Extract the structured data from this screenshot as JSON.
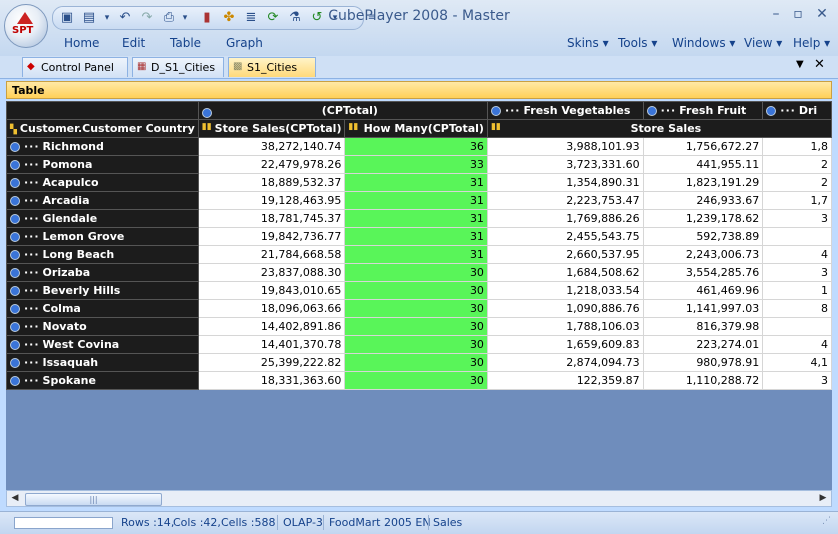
{
  "app": {
    "title": "CubePlayer 2008 - Master",
    "logo_text": "SPT",
    "window_controls": {
      "minimize": "–",
      "maximize": "▫",
      "close": "✕"
    }
  },
  "menu": {
    "left": [
      "Home",
      "Edit",
      "Table",
      "Graph"
    ],
    "right": [
      "Skins",
      "Tools",
      "Windows",
      "View",
      "Help"
    ]
  },
  "tabs": [
    {
      "label": "Control Panel",
      "icon": "spt-icon"
    },
    {
      "label": "D_S1_Cities",
      "icon": "calendar-icon"
    },
    {
      "label": "S1_Cities",
      "icon": "cube-icon",
      "active": true
    }
  ],
  "panel": {
    "title": "Table"
  },
  "table": {
    "top_headers": {
      "cptotal": "(CPTotal)",
      "fresh_veg": "Fresh Vegetables",
      "fresh_fruit": "Fresh Fruit",
      "dri": "Dri"
    },
    "sub_headers": {
      "dimension": "Customer.Customer Country",
      "store_sales_cp": "Store Sales(CPTotal)",
      "how_many_cp": "How Many(CPTotal)",
      "store_sales": "Store Sales"
    },
    "rows": [
      {
        "city": "Richmond",
        "store_sales": "38,272,140.74",
        "how_many": "36",
        "fresh_veg": "3,988,101.93",
        "fresh_fruit": "1,756,672.27",
        "dri": "1,8"
      },
      {
        "city": "Pomona",
        "store_sales": "22,479,978.26",
        "how_many": "33",
        "fresh_veg": "3,723,331.60",
        "fresh_fruit": "441,955.11",
        "dri": "2"
      },
      {
        "city": "Acapulco",
        "store_sales": "18,889,532.37",
        "how_many": "31",
        "fresh_veg": "1,354,890.31",
        "fresh_fruit": "1,823,191.29",
        "dri": "2"
      },
      {
        "city": "Arcadia",
        "store_sales": "19,128,463.95",
        "how_many": "31",
        "fresh_veg": "2,223,753.47",
        "fresh_fruit": "246,933.67",
        "dri": "1,7"
      },
      {
        "city": "Glendale",
        "store_sales": "18,781,745.37",
        "how_many": "31",
        "fresh_veg": "1,769,886.26",
        "fresh_fruit": "1,239,178.62",
        "dri": "3"
      },
      {
        "city": "Lemon Grove",
        "store_sales": "19,842,736.77",
        "how_many": "31",
        "fresh_veg": "2,455,543.75",
        "fresh_fruit": "592,738.89",
        "dri": ""
      },
      {
        "city": "Long Beach",
        "store_sales": "21,784,668.58",
        "how_many": "31",
        "fresh_veg": "2,660,537.95",
        "fresh_fruit": "2,243,006.73",
        "dri": "4"
      },
      {
        "city": "Orizaba",
        "store_sales": "23,837,088.30",
        "how_many": "30",
        "fresh_veg": "1,684,508.62",
        "fresh_fruit": "3,554,285.76",
        "dri": "3"
      },
      {
        "city": "Beverly Hills",
        "store_sales": "19,843,010.65",
        "how_many": "30",
        "fresh_veg": "1,218,033.54",
        "fresh_fruit": "461,469.96",
        "dri": "1"
      },
      {
        "city": "Colma",
        "store_sales": "18,096,063.66",
        "how_many": "30",
        "fresh_veg": "1,090,886.76",
        "fresh_fruit": "1,141,997.03",
        "dri": "8"
      },
      {
        "city": "Novato",
        "store_sales": "14,402,891.86",
        "how_many": "30",
        "fresh_veg": "1,788,106.03",
        "fresh_fruit": "816,379.98",
        "dri": ""
      },
      {
        "city": "West Covina",
        "store_sales": "14,401,370.78",
        "how_many": "30",
        "fresh_veg": "1,659,609.83",
        "fresh_fruit": "223,274.01",
        "dri": "4"
      },
      {
        "city": "Issaquah",
        "store_sales": "25,399,222.82",
        "how_many": "30",
        "fresh_veg": "2,874,094.73",
        "fresh_fruit": "980,978.91",
        "dri": "4,1"
      },
      {
        "city": "Spokane",
        "store_sales": "18,331,363.60",
        "how_many": "30",
        "fresh_veg": "122,359.87",
        "fresh_fruit": "1,110,288.72",
        "dri": "3"
      }
    ]
  },
  "status": {
    "rows": "Rows :14",
    "cols": "Cols :42",
    "cells": "Cells :588",
    "olap": "OLAP-3",
    "db": "FoodMart 2005 EN",
    "cube": "Sales"
  },
  "colors": {
    "highlight_green": "#59f559",
    "row_header": "#1c1c1c",
    "panel_header": "#ffd058"
  }
}
